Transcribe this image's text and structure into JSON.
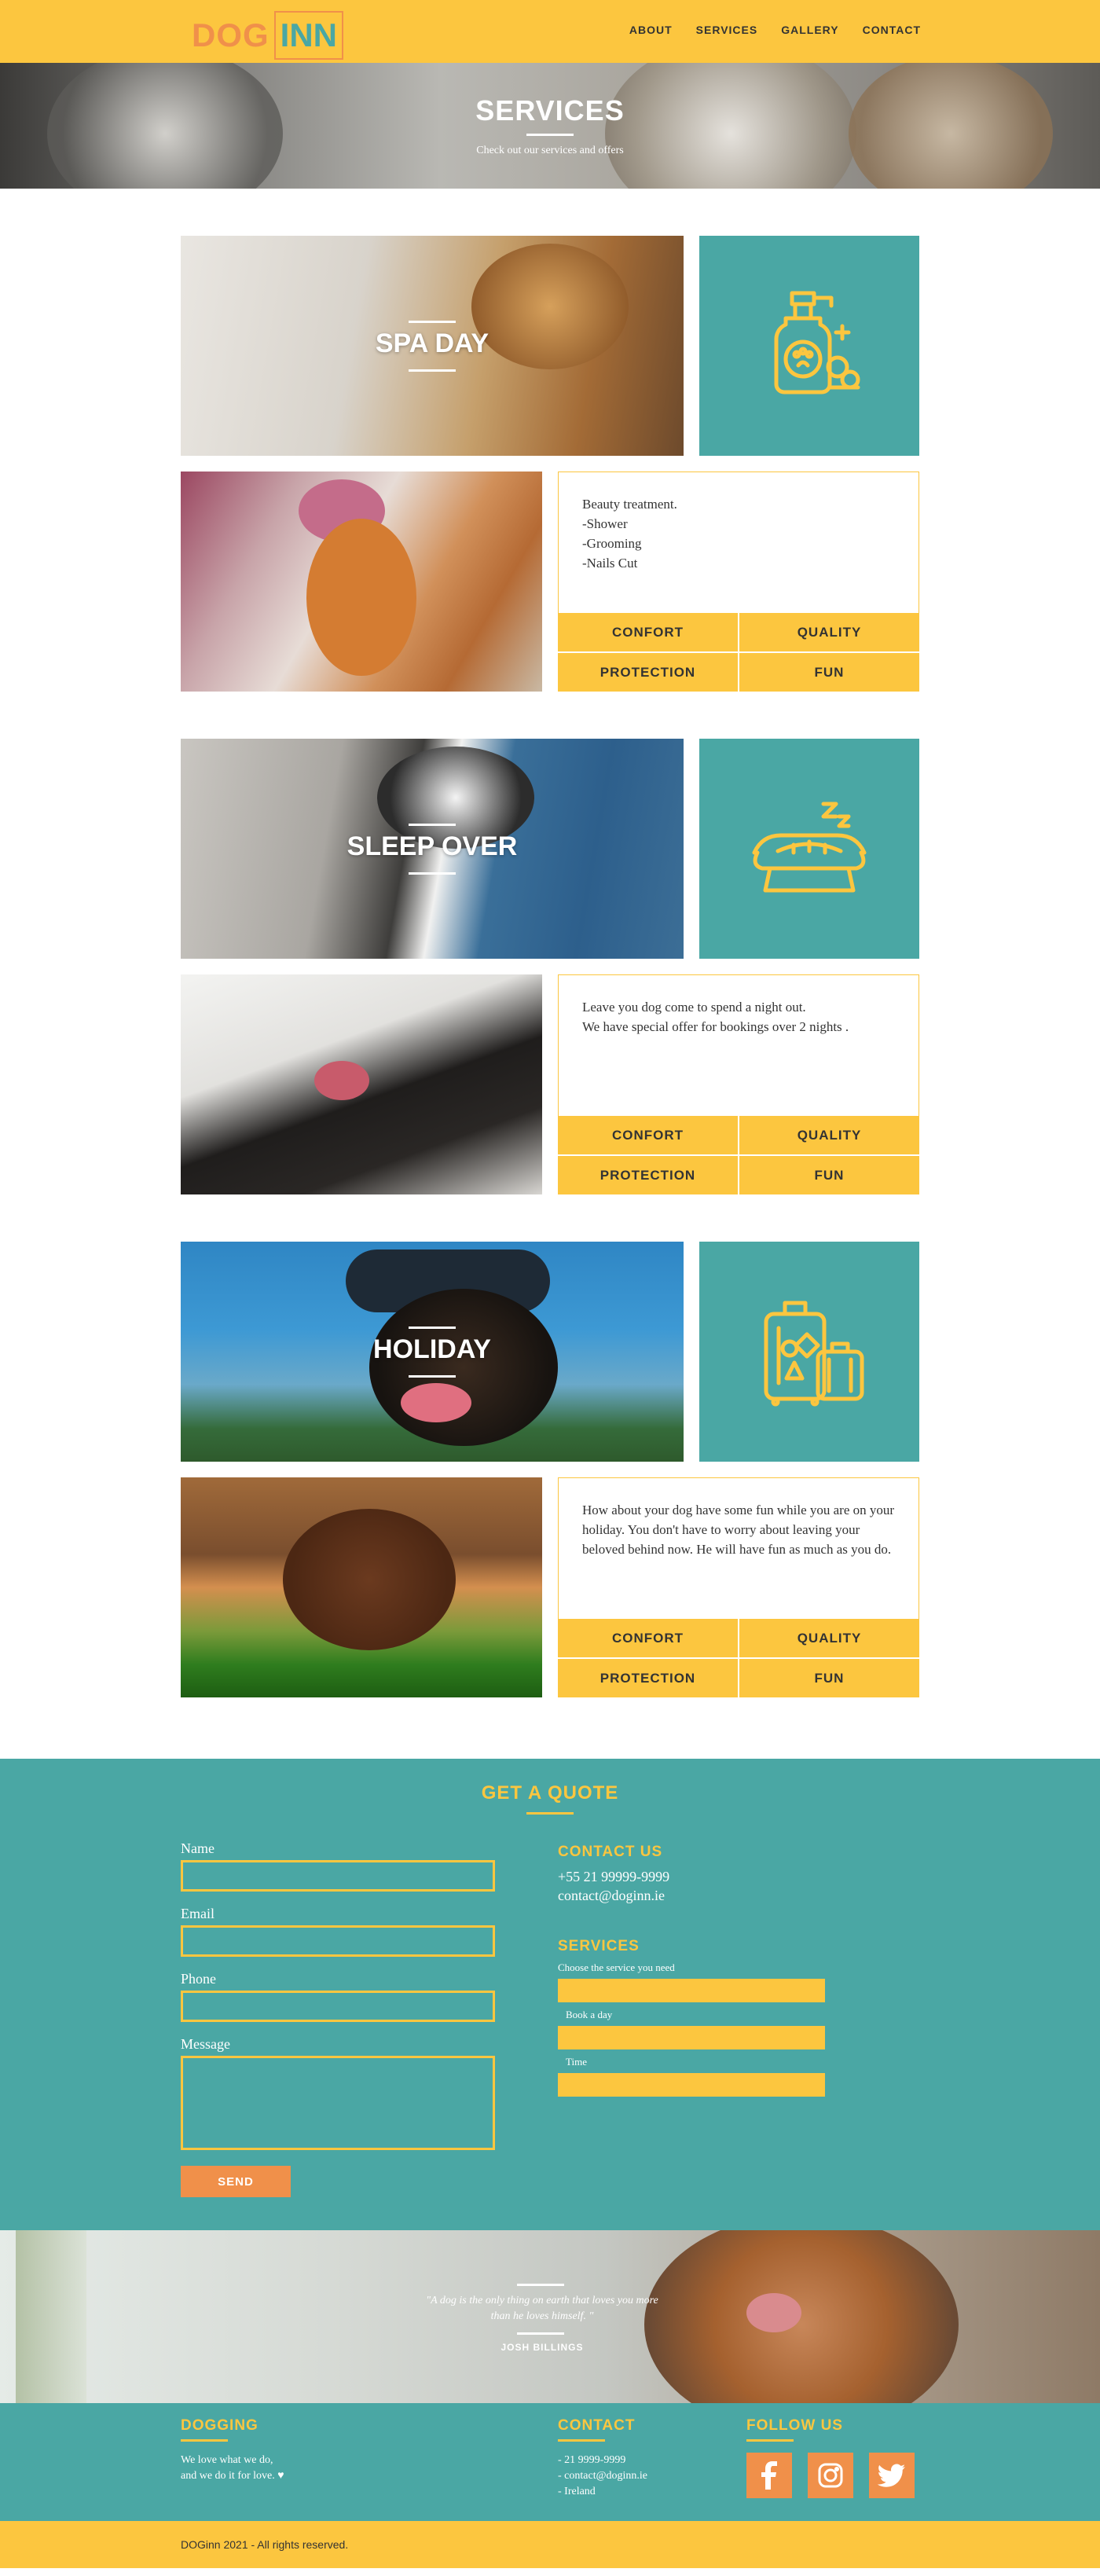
{
  "nav": {
    "logo_left": "DOG",
    "logo_right": "INN",
    "links": [
      "ABOUT",
      "SERVICES",
      "GALLERY",
      "CONTACT"
    ]
  },
  "hero": {
    "title": "SERVICES",
    "subtitle": "Check out our services and offers"
  },
  "services": [
    {
      "title": "SPA DAY",
      "icon": "shampoo-bottle-icon",
      "description": "Beauty treatment.\n-Shower\n-Grooming\n-Nails Cut",
      "tags": [
        "CONFORT",
        "QUALITY",
        "PROTECTION",
        "FUN"
      ]
    },
    {
      "title": "SLEEP OVER",
      "icon": "dog-bed-icon",
      "description": "Leave you dog come to spend a night out.\nWe have special offer for bookings over 2 nights .",
      "tags": [
        "CONFORT",
        "QUALITY",
        "PROTECTION",
        "FUN"
      ]
    },
    {
      "title": "HOLIDAY",
      "icon": "luggage-icon",
      "description": "How about your dog have some fun while you are on your holiday. You don't have to worry about leaving your beloved behind now. He will have fun as much as you do.",
      "tags": [
        "CONFORT",
        "QUALITY",
        "PROTECTION",
        "FUN"
      ]
    }
  ],
  "quote": {
    "title": "GET A QUOTE",
    "form": {
      "name_label": "Name",
      "email_label": "Email",
      "phone_label": "Phone",
      "message_label": "Message",
      "send_label": "SEND"
    },
    "contact": {
      "heading": "CONTACT US",
      "phone": "+55 21 99999-9999",
      "email": "contact@doginn.ie"
    },
    "services": {
      "heading": "SERVICES",
      "hint": "Choose the service you need",
      "book_label": "Book a day",
      "time_label": "Time"
    }
  },
  "testimonial": {
    "quote": "\"A dog is the only thing on earth that loves you more than he loves himself. \"",
    "author": "JOSH BILLINGS"
  },
  "footer": {
    "brand_heading": "DOGGING",
    "brand_text": "We love what we do,\nand we do it for love. ♥",
    "contact_heading": "CONTACT",
    "contact_text": "- 21 9999-9999\n- contact@doginn.ie\n- Ireland",
    "follow_heading": "FOLLOW US",
    "copyright": "DOGinn 2021 - All rights reserved."
  },
  "colors": {
    "yellow": "#fcc63f",
    "teal": "#4aa7a4",
    "orange": "#f0904a"
  }
}
